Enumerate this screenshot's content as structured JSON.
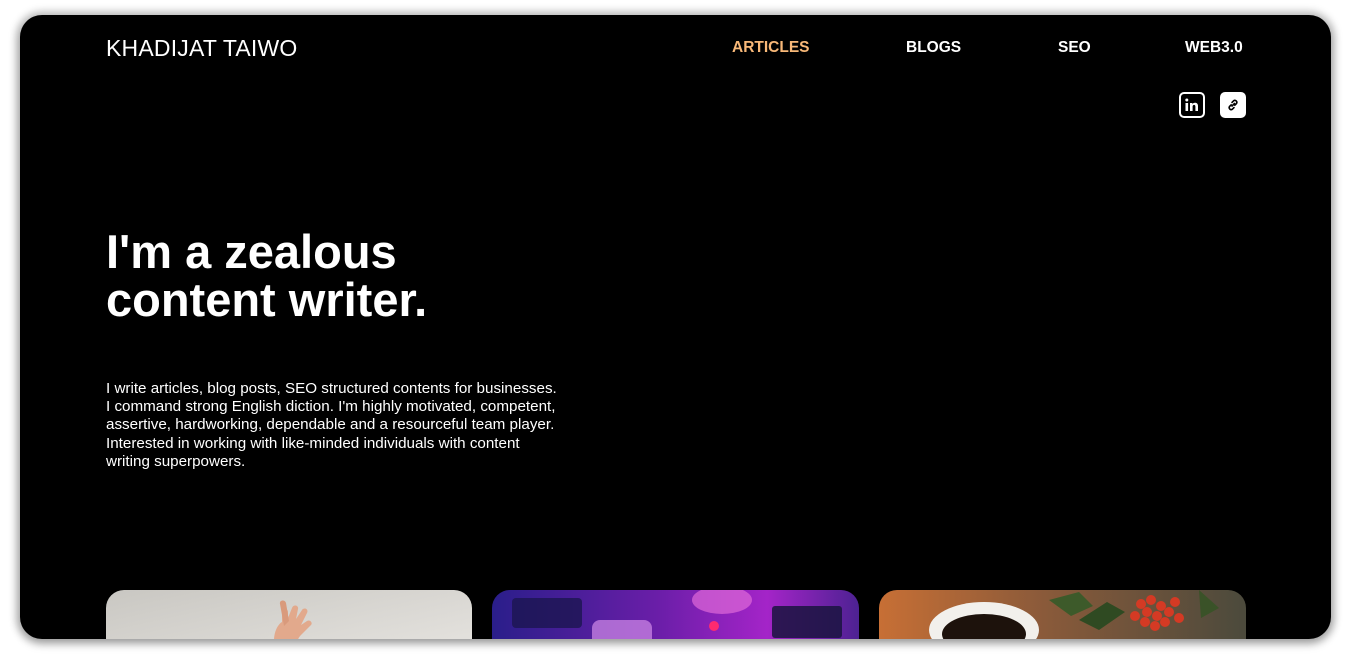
{
  "brand": {
    "name": "KHADIJAT TAIWO"
  },
  "nav": {
    "items": [
      {
        "label": "ARTICLES",
        "active": true
      },
      {
        "label": "BLOGS",
        "active": false
      },
      {
        "label": "SEO",
        "active": false
      },
      {
        "label": "WEB3.0",
        "active": false
      }
    ],
    "active_color": "#f8b878"
  },
  "social": [
    {
      "icon": "linkedin-icon"
    },
    {
      "icon": "link-icon"
    }
  ],
  "hero": {
    "headline": "I'm a zealous content writer.",
    "bio": "I write articles, blog posts, SEO structured contents for businesses. I command strong English diction. I'm highly motivated, competent, assertive, hardworking, dependable and a resourceful team player. Interested in working with like-minded individuals with content writing superpowers."
  },
  "cards": [
    {
      "image": "hand-photo"
    },
    {
      "image": "desk-neon-photo"
    },
    {
      "image": "coffee-berries-photo"
    }
  ],
  "colors": {
    "background": "#000000",
    "text": "#ffffff",
    "accent": "#f8b878"
  }
}
